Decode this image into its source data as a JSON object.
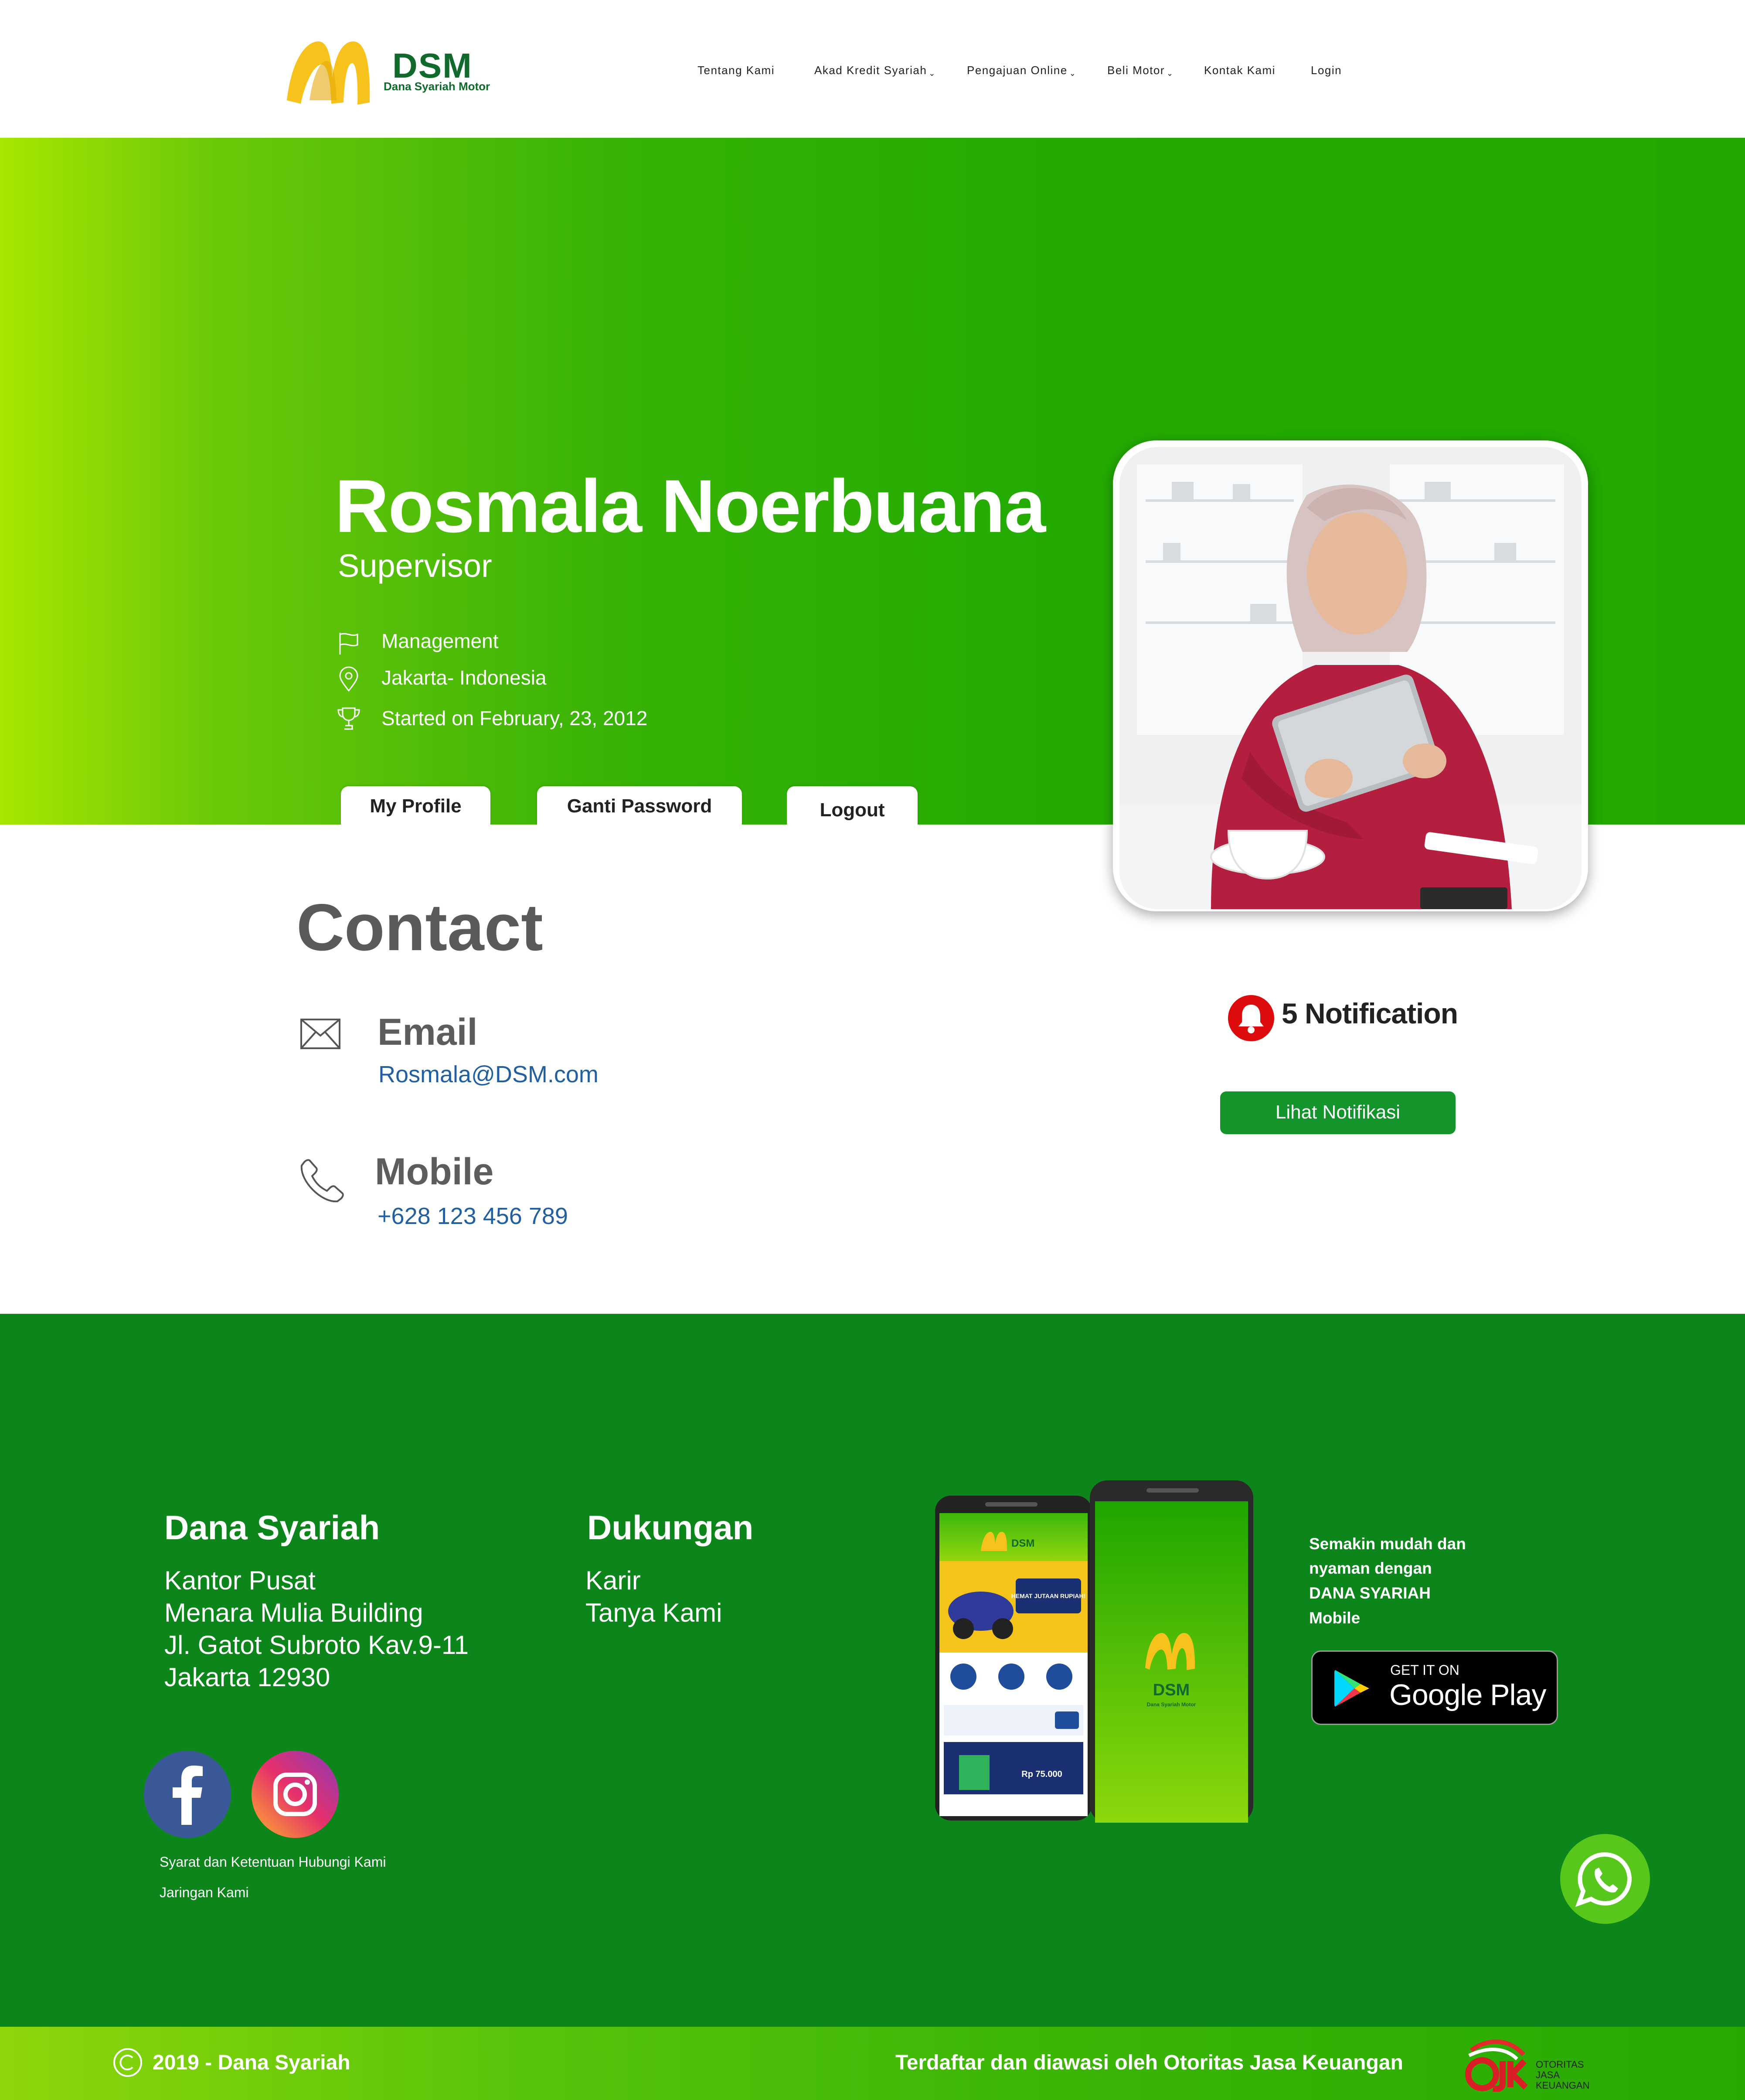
{
  "header": {
    "logo_name": "DSM",
    "logo_tagline": "Dana Syariah Motor",
    "nav": [
      {
        "label": "Tentang Kami"
      },
      {
        "label": "Akad Kredit Syariah"
      },
      {
        "label": "Pengajuan Online"
      },
      {
        "label": "Beli Motor"
      },
      {
        "label": "Kontak Kami"
      },
      {
        "label": "Login"
      }
    ]
  },
  "profile": {
    "name": "Rosmala Noerbuana",
    "role": "Supervisor",
    "department": "Management",
    "location": "Jakarta- Indonesia",
    "started": "Started on February, 23, 2012",
    "tabs": [
      {
        "label": "My Profile"
      },
      {
        "label": "Ganti Password"
      },
      {
        "label": "Logout"
      }
    ]
  },
  "contact": {
    "title": "Contact",
    "email_label": "Email",
    "email_value": "Rosmala@DSM.com",
    "mobile_label": "Mobile",
    "mobile_value": "+628 123 456 789"
  },
  "notification": {
    "text": "5 Notification",
    "button_label": "Lihat Notifikasi"
  },
  "footer": {
    "company_title": "Dana Syariah",
    "address": [
      "Kantor Pusat",
      "Menara Mulia Building",
      "Jl. Gatot Subroto Kav.9-11",
      "Jakarta 12930"
    ],
    "support_title": "Dukungan",
    "support_links": [
      "Karir",
      "Tanya Kami"
    ],
    "small_links": [
      "Syarat dan Ketentuan",
      "Hubungi Kami",
      "Jaringan Kami"
    ],
    "promo_lines": [
      "Semakin mudah dan",
      "nyaman dengan",
      "DANA SYARIAH",
      "Mobile"
    ],
    "gplay_small": "GET IT ON",
    "gplay_big": "Google Play",
    "phone_brand": "DSM",
    "phone_tagline": "Dana Syariah Motor",
    "phone_banner": "HEMAT JUTAAN RUPIAH!",
    "phone_price": "Rp 75.000",
    "copyright": "2019 - Dana Syariah",
    "ojk_text": "Terdaftar dan diawasi oleh Otoritas Jasa Keuangan",
    "ojk_logo": [
      "OTORITAS",
      "JASA",
      "KEUANGAN"
    ]
  },
  "icons": [
    "flag-icon",
    "location-pin-icon",
    "trophy-icon",
    "envelope-icon",
    "phone-icon",
    "bell-icon",
    "facebook-icon",
    "instagram-icon",
    "whatsapp-icon",
    "copyright-icon",
    "google-play-icon"
  ],
  "colors": {
    "hero_green": "#21a900",
    "hero_lime": "#a7e600",
    "footer_green": "#0c861a",
    "button_green": "#14952c",
    "link_blue": "#1f5fa2",
    "bell_red": "#dd0b0b",
    "logo_yellow": "#f7c21b"
  }
}
